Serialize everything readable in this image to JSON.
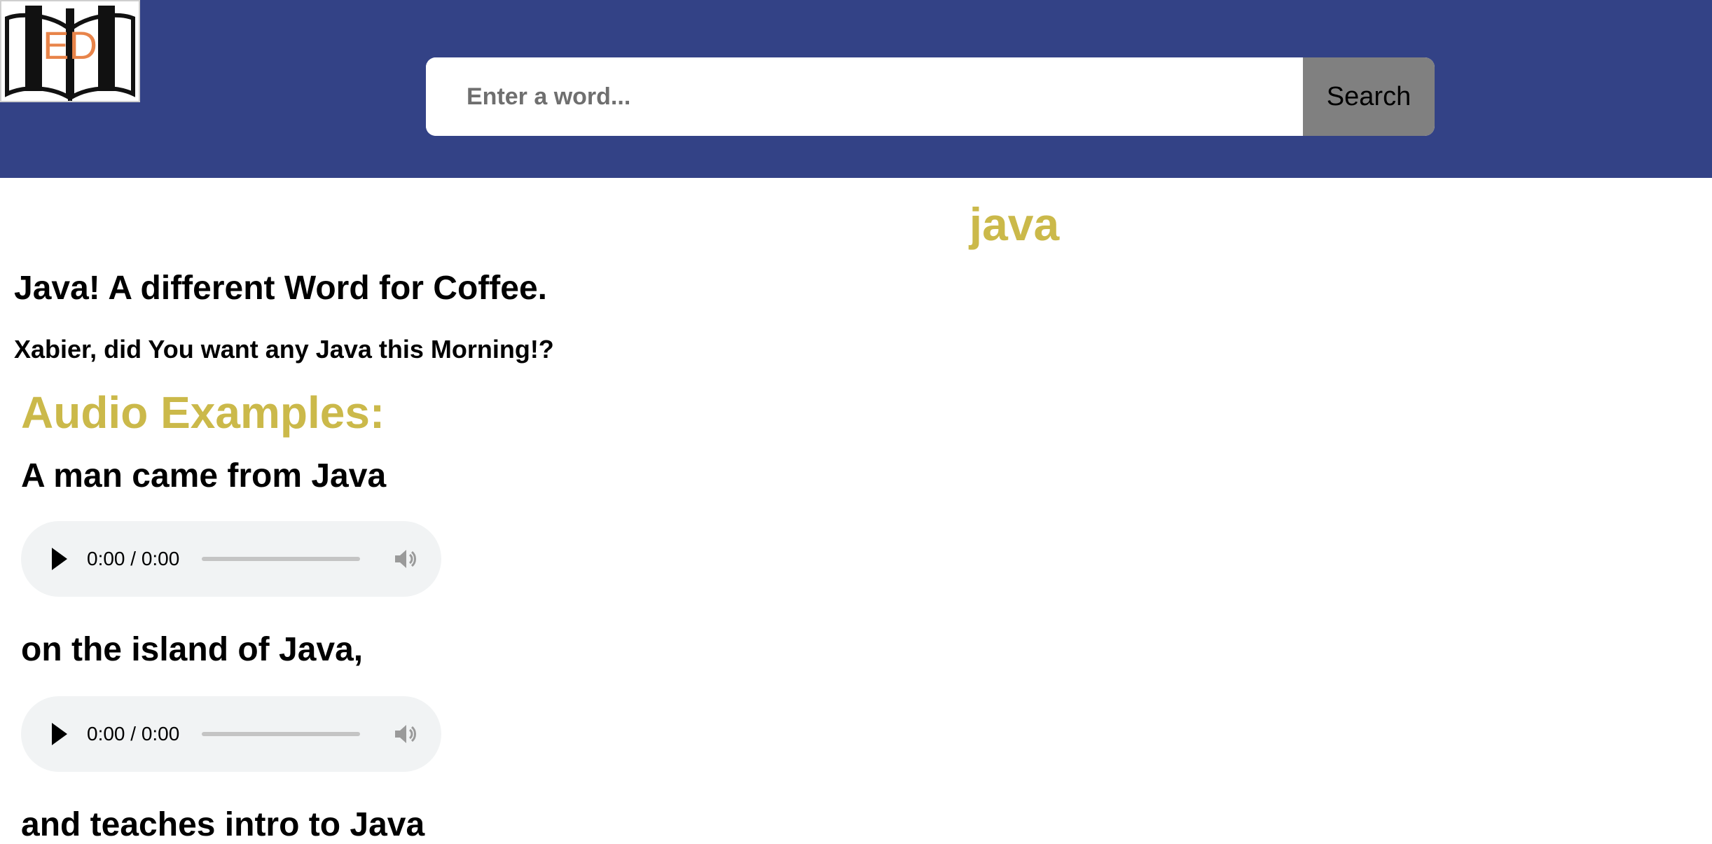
{
  "header": {
    "logo_text": "ED",
    "search": {
      "placeholder": "Enter a word...",
      "value": "",
      "button_label": "Search"
    }
  },
  "entry": {
    "word": "java",
    "definition": "Java! A different Word for Coffee.",
    "example": "Xabier, did You want any Java this Morning!?"
  },
  "audio_section": {
    "heading": "Audio Examples:",
    "items": [
      {
        "label": "A man came from Java",
        "time": "0:00 / 0:00",
        "progress": 0
      },
      {
        "label": "on the island of Java,",
        "time": "0:00 / 0:00",
        "progress": 0
      },
      {
        "label": "and teaches intro to Java"
      }
    ]
  },
  "colors": {
    "header_bg": "#334286",
    "accent": "#cbb94a",
    "logo_letters": "#e8844a",
    "search_button_bg": "#808080",
    "player_bg": "#f1f3f4"
  },
  "icons": {
    "logo": "open-book-icon",
    "play": "play-icon",
    "volume": "volume-icon"
  }
}
